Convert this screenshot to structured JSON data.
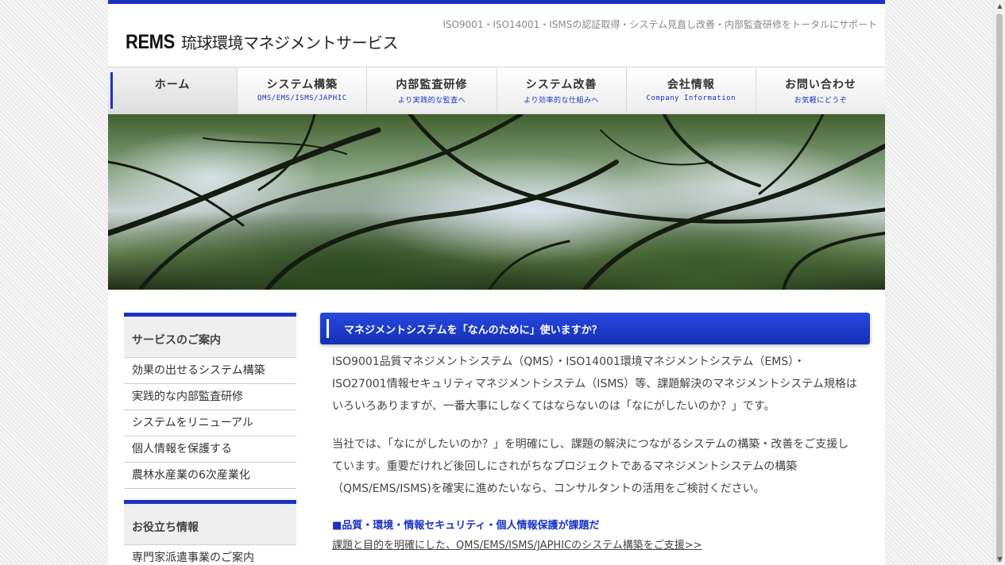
{
  "header": {
    "logo_mark": "REMS",
    "logo_text": "琉球環境マネジメントサービス",
    "tagline": "ISO9001・ISO14001・ISMSの認証取得・システム見直し改善・内部監査研修をトータルにサポート"
  },
  "nav": [
    {
      "label": "ホーム",
      "sub": ""
    },
    {
      "label": "システム構築",
      "sub": "QMS/EMS/ISMS/JAPHIC"
    },
    {
      "label": "内部監査研修",
      "sub": "より実践的な監査へ"
    },
    {
      "label": "システム改善",
      "sub": "より効率的な仕組みへ"
    },
    {
      "label": "会社情報",
      "sub": "Company Information"
    },
    {
      "label": "お問い合わせ",
      "sub": "お気軽にどうぞ"
    }
  ],
  "sidebar": {
    "services_title": "サービスのご案内",
    "services": [
      "効果の出せるシステム構築",
      "実践的な内部監査研修",
      "システムをリニューアル",
      "個人情報を保護する",
      "農林水産業の6次産業化"
    ],
    "info_title": "お役立ち情報",
    "info_items": [
      "専門家派遣事業のご案内"
    ]
  },
  "main": {
    "heading": "マネジメントシステムを「なんのために」使いますか？",
    "p1_l1": "ISO9001品質マネジメントシステム（QMS）・ISO14001環境マネジメントシステム（EMS）・",
    "p1_l2": "ISO27001情報セキュリティマネジメントシステム（ISMS）等、課題解決のマネジメントシステム規格は",
    "p1_l3": "いろいろありますが、一番大事にしなくてはならないのは「なにがしたいのか？」です。",
    "p2_l1": "当社では、「なにがしたいのか？」を明確にし、課題の解決につながるシステムの構築・改善をご支援し",
    "p2_l2": "ています。重要だけれど後回しにされがちなプロジェクトであるマネジメントシステムの構築",
    "p2_l3": "（QMS/EMS/ISMS)を確実に進めたいなら、コンサルタントの活用をご検討ください。",
    "subheading": "■品質・環境・情報セキュリティ・個人情報保護が課題だ",
    "link": "課題と目的を明確にした、QMS/EMS/ISMS/JAPHICのシステム構築をご支援>>"
  },
  "scrollbar": {
    "up": "▲",
    "down": "▼"
  }
}
